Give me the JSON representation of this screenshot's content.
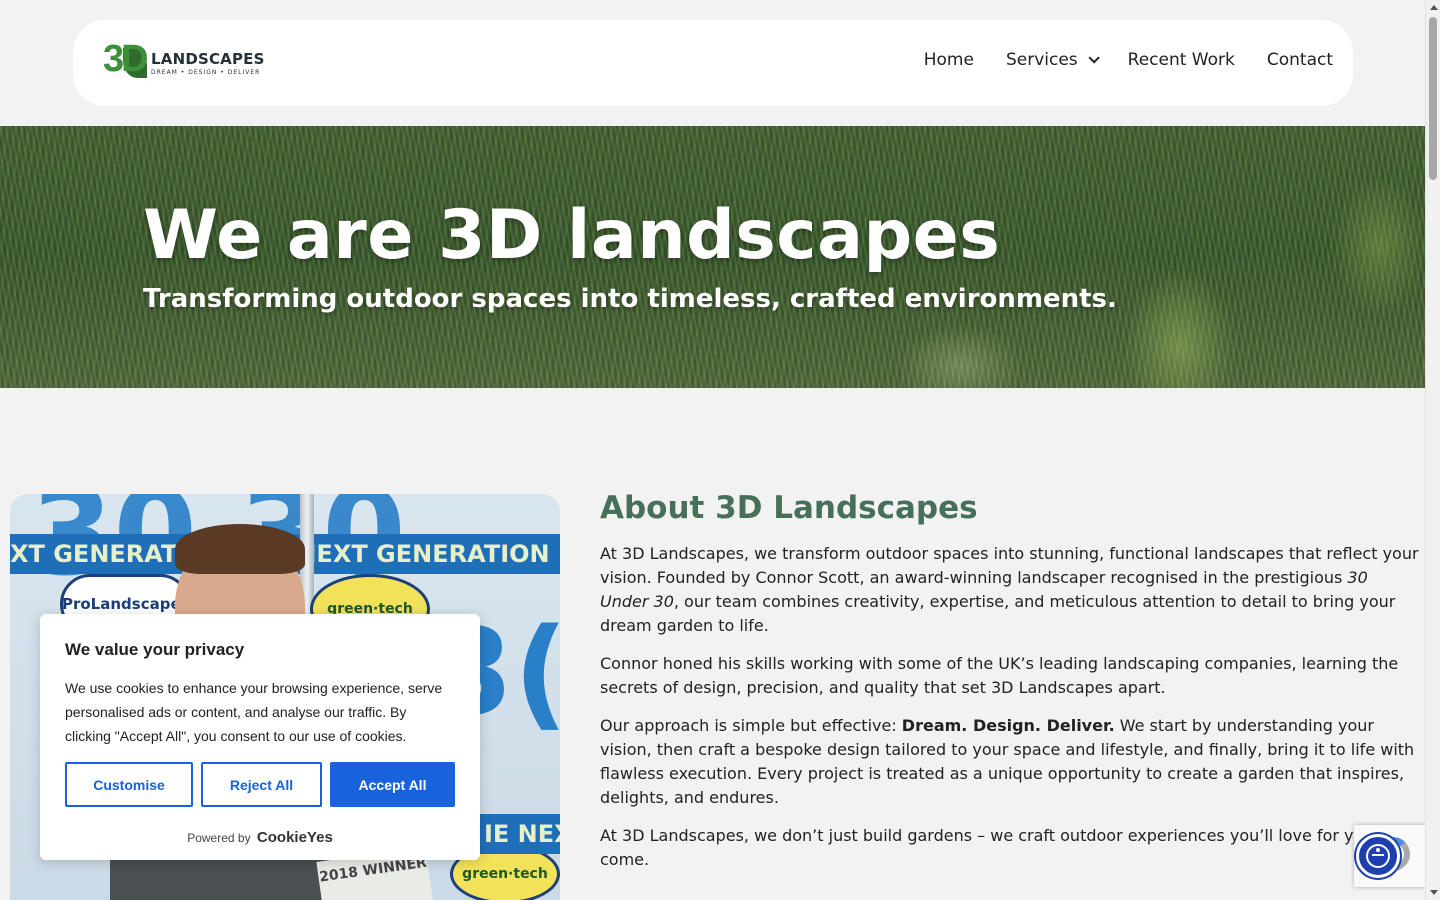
{
  "header": {
    "logo_mark": "3D",
    "logo_title": "LANDSCAPES",
    "logo_tagline": "DREAM • DESIGN • DELIVER",
    "nav": {
      "home": "Home",
      "services": "Services",
      "recent_work": "Recent Work",
      "contact": "Contact"
    }
  },
  "hero": {
    "title": "We are 3D landscapes",
    "subtitle": "Transforming outdoor spaces into timeless, crafted environments."
  },
  "photo": {
    "banner_text_1": "XT GENERATION   THE NEXT GENERATION",
    "banner_text_2": "IE NEXT",
    "bubble_1": "ProLandscaper",
    "bubble_2": "green·tech",
    "bubble_3": "green·tech",
    "award": "2018 WINNER"
  },
  "about": {
    "heading": "About 3D Landscapes",
    "p1_a": "At 3D Landscapes, we transform outdoor spaces into stunning, functional landscapes that reflect your vision. Founded by Connor Scott, an award-winning landscaper recognised in the prestigious ",
    "p1_em": "30 Under 30",
    "p1_b": ", our team combines creativity, expertise, and meticulous attention to detail to bring your dream garden to life.",
    "p2": "Connor honed his skills working with some of the UK’s leading landscaping companies, learning the secrets of design, precision, and quality that set 3D Landscapes apart.",
    "p3_a": "Our approach is simple but effective: ",
    "p3_strong": "Dream. Design. Deliver.",
    "p3_b": " We start by understanding your vision, then craft a bespoke design tailored to your space and lifestyle, and finally, bring it to life with flawless execution. Every project is treated as a unique opportunity to create a garden that inspires, delights, and endures.",
    "p4": "At 3D Landscapes, we don’t just build gardens – we craft outdoor experiences you’ll love for years to come."
  },
  "cookie": {
    "title": "We value your privacy",
    "body": "We use cookies to enhance your browsing experience, serve personalised ads or content, and analyse our traffic. By clicking \"Accept All\", you consent to our use of cookies.",
    "customise": "Customise",
    "reject": "Reject All",
    "accept": "Accept All",
    "powered_by": "Powered by",
    "brand": "CookieYes"
  },
  "colors": {
    "accent_green": "#47705a",
    "cookie_blue": "#1863dc",
    "a11y_blue": "#1e40af"
  },
  "icons": {
    "services_dropdown": "chevron-down-icon",
    "accessibility": "accessibility-icon",
    "recaptcha": "recaptcha-icon"
  }
}
